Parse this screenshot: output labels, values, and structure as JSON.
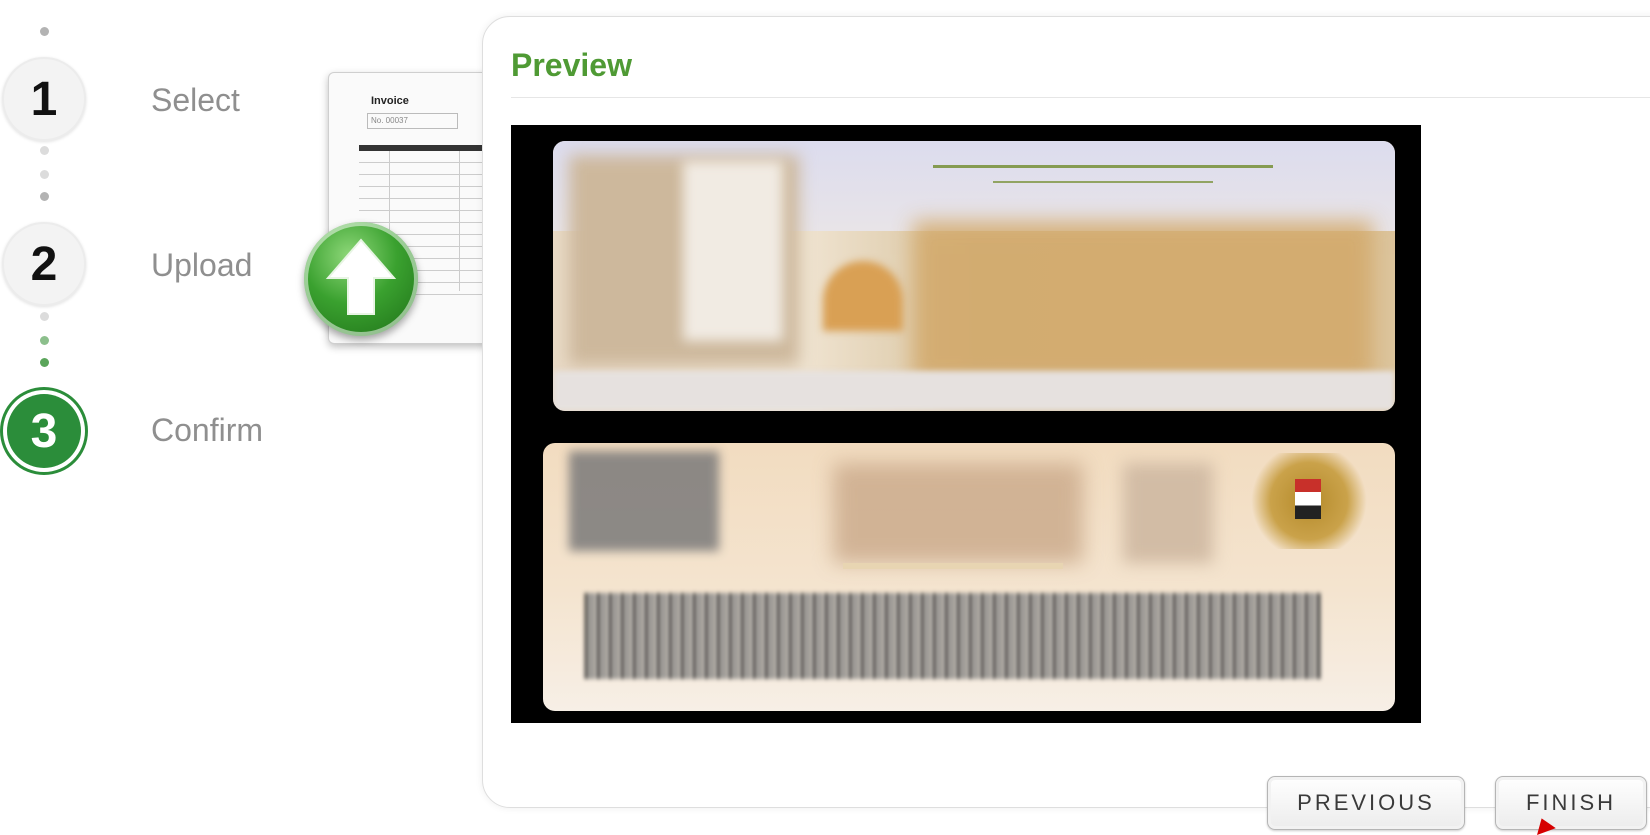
{
  "steps": [
    {
      "number": "1",
      "label": "Select",
      "state": "done"
    },
    {
      "number": "2",
      "label": "Upload",
      "state": "done"
    },
    {
      "number": "3",
      "label": "Confirm",
      "state": "active"
    }
  ],
  "illustration": {
    "invoice_title": "Invoice",
    "invoice_no": "No. 00037",
    "icon": "upload-arrow-icon"
  },
  "preview": {
    "title": "Preview"
  },
  "buttons": {
    "previous": "PREVIOUS",
    "finish": "FINISH"
  },
  "colors": {
    "accent_green": "#4f9a34",
    "active_step": "#2b8d3a"
  }
}
